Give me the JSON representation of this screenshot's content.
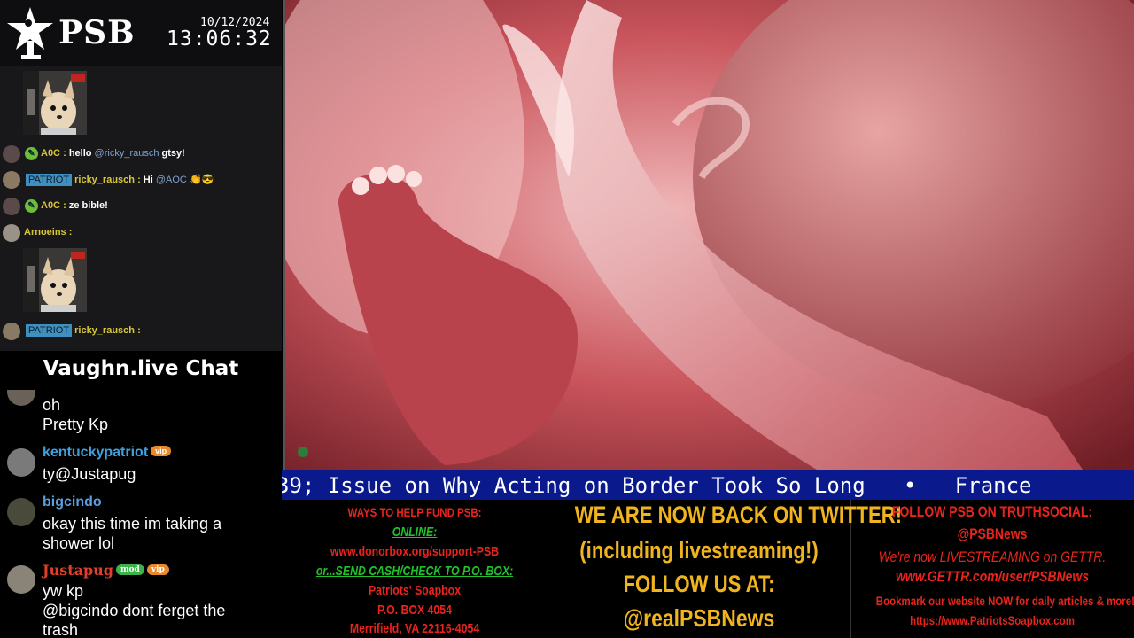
{
  "header": {
    "logo_text": "PSB",
    "date": "10/12/2024",
    "time": "13:06:32"
  },
  "top_chat": {
    "messages": [
      {
        "user": "A0C",
        "text": "hello",
        "mention": "@ricky_rausch",
        "after": "gtsy!"
      },
      {
        "user": "ricky_rausch",
        "badge": "PATRIOT",
        "text": "Hi",
        "mention": "@AOC",
        "emoji": "👏😎"
      },
      {
        "user": "A0C",
        "text": "ze bible!"
      },
      {
        "user": "Arnoeins",
        "text": ""
      },
      {
        "user": "ricky_rausch",
        "badge": "PATRIOT",
        "text": ""
      }
    ],
    "separator": ":",
    "colors": {
      "name": "#d8c73a",
      "mention": "#7ea0d0",
      "badge": "#3f8fc0"
    }
  },
  "lower_title": "Vaughn.live Chat",
  "lower_chat": {
    "messages": [
      {
        "user": "",
        "lines": [
          "oh",
          "Pretty Kp"
        ]
      },
      {
        "user": "kentuckypatriot",
        "name_color": "#3fa0e0",
        "tags": [
          "vip"
        ],
        "lines": [
          "ty@Justapug"
        ]
      },
      {
        "user": "bigcindo",
        "name_color": "#5a9ee0",
        "tags": [],
        "lines": [
          "okay this time im taking a",
          "shower lol"
        ]
      },
      {
        "user": "Justapug",
        "name_color": "#e0402a",
        "tags": [
          "mod",
          "vip"
        ],
        "lines": [
          "yw kp",
          "@bigcindo dont ferget the",
          "trash"
        ]
      }
    ]
  },
  "ticker": {
    "text": "39; Issue on Why Acting on Border Took So Long   •   France",
    "bg": "#0a1a8c"
  },
  "footer": {
    "col1": {
      "title": "WAYS TO HELP FUND PSB:",
      "online_label": "ONLINE:",
      "online_url": "www.donorbox.org/support-PSB",
      "cash_label": "or...SEND CASH/CHECK TO P.O. BOX:",
      "addr1": "Patriots' Soapbox",
      "addr2": "P.O. BOX 4054",
      "addr3": "Merrifield, VA 22116-4054"
    },
    "col2": {
      "line1": "WE ARE NOW BACK ON TWITTER!",
      "line2": "(including livestreaming!)",
      "line3": "FOLLOW US AT:",
      "line4": "@realPSBNews"
    },
    "col3": {
      "line1": "FOLLOW PSB ON TRUTHSOCIAL:",
      "line2": "@PSBNews",
      "line3": "We're now LIVESTREAMING on GETTR.",
      "line4": "www.GETTR.com/user/PSBNews",
      "line5": "Bookmark our website NOW for daily articles & more!",
      "line6": "https://www.PatriotsSoapbox.com"
    },
    "colors": {
      "red": "#e8241c",
      "green": "#22c02c",
      "yellow": "#f0b41e"
    }
  }
}
